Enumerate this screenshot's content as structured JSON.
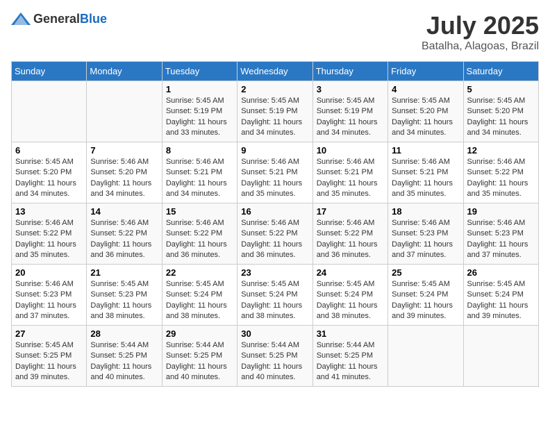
{
  "header": {
    "logo_general": "General",
    "logo_blue": "Blue",
    "month": "July 2025",
    "location": "Batalha, Alagoas, Brazil"
  },
  "days_of_week": [
    "Sunday",
    "Monday",
    "Tuesday",
    "Wednesday",
    "Thursday",
    "Friday",
    "Saturday"
  ],
  "weeks": [
    [
      {
        "day": "",
        "content": ""
      },
      {
        "day": "",
        "content": ""
      },
      {
        "day": "1",
        "content": "Sunrise: 5:45 AM\nSunset: 5:19 PM\nDaylight: 11 hours and 33 minutes."
      },
      {
        "day": "2",
        "content": "Sunrise: 5:45 AM\nSunset: 5:19 PM\nDaylight: 11 hours and 34 minutes."
      },
      {
        "day": "3",
        "content": "Sunrise: 5:45 AM\nSunset: 5:19 PM\nDaylight: 11 hours and 34 minutes."
      },
      {
        "day": "4",
        "content": "Sunrise: 5:45 AM\nSunset: 5:20 PM\nDaylight: 11 hours and 34 minutes."
      },
      {
        "day": "5",
        "content": "Sunrise: 5:45 AM\nSunset: 5:20 PM\nDaylight: 11 hours and 34 minutes."
      }
    ],
    [
      {
        "day": "6",
        "content": "Sunrise: 5:45 AM\nSunset: 5:20 PM\nDaylight: 11 hours and 34 minutes."
      },
      {
        "day": "7",
        "content": "Sunrise: 5:46 AM\nSunset: 5:20 PM\nDaylight: 11 hours and 34 minutes."
      },
      {
        "day": "8",
        "content": "Sunrise: 5:46 AM\nSunset: 5:21 PM\nDaylight: 11 hours and 34 minutes."
      },
      {
        "day": "9",
        "content": "Sunrise: 5:46 AM\nSunset: 5:21 PM\nDaylight: 11 hours and 35 minutes."
      },
      {
        "day": "10",
        "content": "Sunrise: 5:46 AM\nSunset: 5:21 PM\nDaylight: 11 hours and 35 minutes."
      },
      {
        "day": "11",
        "content": "Sunrise: 5:46 AM\nSunset: 5:21 PM\nDaylight: 11 hours and 35 minutes."
      },
      {
        "day": "12",
        "content": "Sunrise: 5:46 AM\nSunset: 5:22 PM\nDaylight: 11 hours and 35 minutes."
      }
    ],
    [
      {
        "day": "13",
        "content": "Sunrise: 5:46 AM\nSunset: 5:22 PM\nDaylight: 11 hours and 35 minutes."
      },
      {
        "day": "14",
        "content": "Sunrise: 5:46 AM\nSunset: 5:22 PM\nDaylight: 11 hours and 36 minutes."
      },
      {
        "day": "15",
        "content": "Sunrise: 5:46 AM\nSunset: 5:22 PM\nDaylight: 11 hours and 36 minutes."
      },
      {
        "day": "16",
        "content": "Sunrise: 5:46 AM\nSunset: 5:22 PM\nDaylight: 11 hours and 36 minutes."
      },
      {
        "day": "17",
        "content": "Sunrise: 5:46 AM\nSunset: 5:22 PM\nDaylight: 11 hours and 36 minutes."
      },
      {
        "day": "18",
        "content": "Sunrise: 5:46 AM\nSunset: 5:23 PM\nDaylight: 11 hours and 37 minutes."
      },
      {
        "day": "19",
        "content": "Sunrise: 5:46 AM\nSunset: 5:23 PM\nDaylight: 11 hours and 37 minutes."
      }
    ],
    [
      {
        "day": "20",
        "content": "Sunrise: 5:46 AM\nSunset: 5:23 PM\nDaylight: 11 hours and 37 minutes."
      },
      {
        "day": "21",
        "content": "Sunrise: 5:45 AM\nSunset: 5:23 PM\nDaylight: 11 hours and 38 minutes."
      },
      {
        "day": "22",
        "content": "Sunrise: 5:45 AM\nSunset: 5:24 PM\nDaylight: 11 hours and 38 minutes."
      },
      {
        "day": "23",
        "content": "Sunrise: 5:45 AM\nSunset: 5:24 PM\nDaylight: 11 hours and 38 minutes."
      },
      {
        "day": "24",
        "content": "Sunrise: 5:45 AM\nSunset: 5:24 PM\nDaylight: 11 hours and 38 minutes."
      },
      {
        "day": "25",
        "content": "Sunrise: 5:45 AM\nSunset: 5:24 PM\nDaylight: 11 hours and 39 minutes."
      },
      {
        "day": "26",
        "content": "Sunrise: 5:45 AM\nSunset: 5:24 PM\nDaylight: 11 hours and 39 minutes."
      }
    ],
    [
      {
        "day": "27",
        "content": "Sunrise: 5:45 AM\nSunset: 5:25 PM\nDaylight: 11 hours and 39 minutes."
      },
      {
        "day": "28",
        "content": "Sunrise: 5:44 AM\nSunset: 5:25 PM\nDaylight: 11 hours and 40 minutes."
      },
      {
        "day": "29",
        "content": "Sunrise: 5:44 AM\nSunset: 5:25 PM\nDaylight: 11 hours and 40 minutes."
      },
      {
        "day": "30",
        "content": "Sunrise: 5:44 AM\nSunset: 5:25 PM\nDaylight: 11 hours and 40 minutes."
      },
      {
        "day": "31",
        "content": "Sunrise: 5:44 AM\nSunset: 5:25 PM\nDaylight: 11 hours and 41 minutes."
      },
      {
        "day": "",
        "content": ""
      },
      {
        "day": "",
        "content": ""
      }
    ]
  ]
}
